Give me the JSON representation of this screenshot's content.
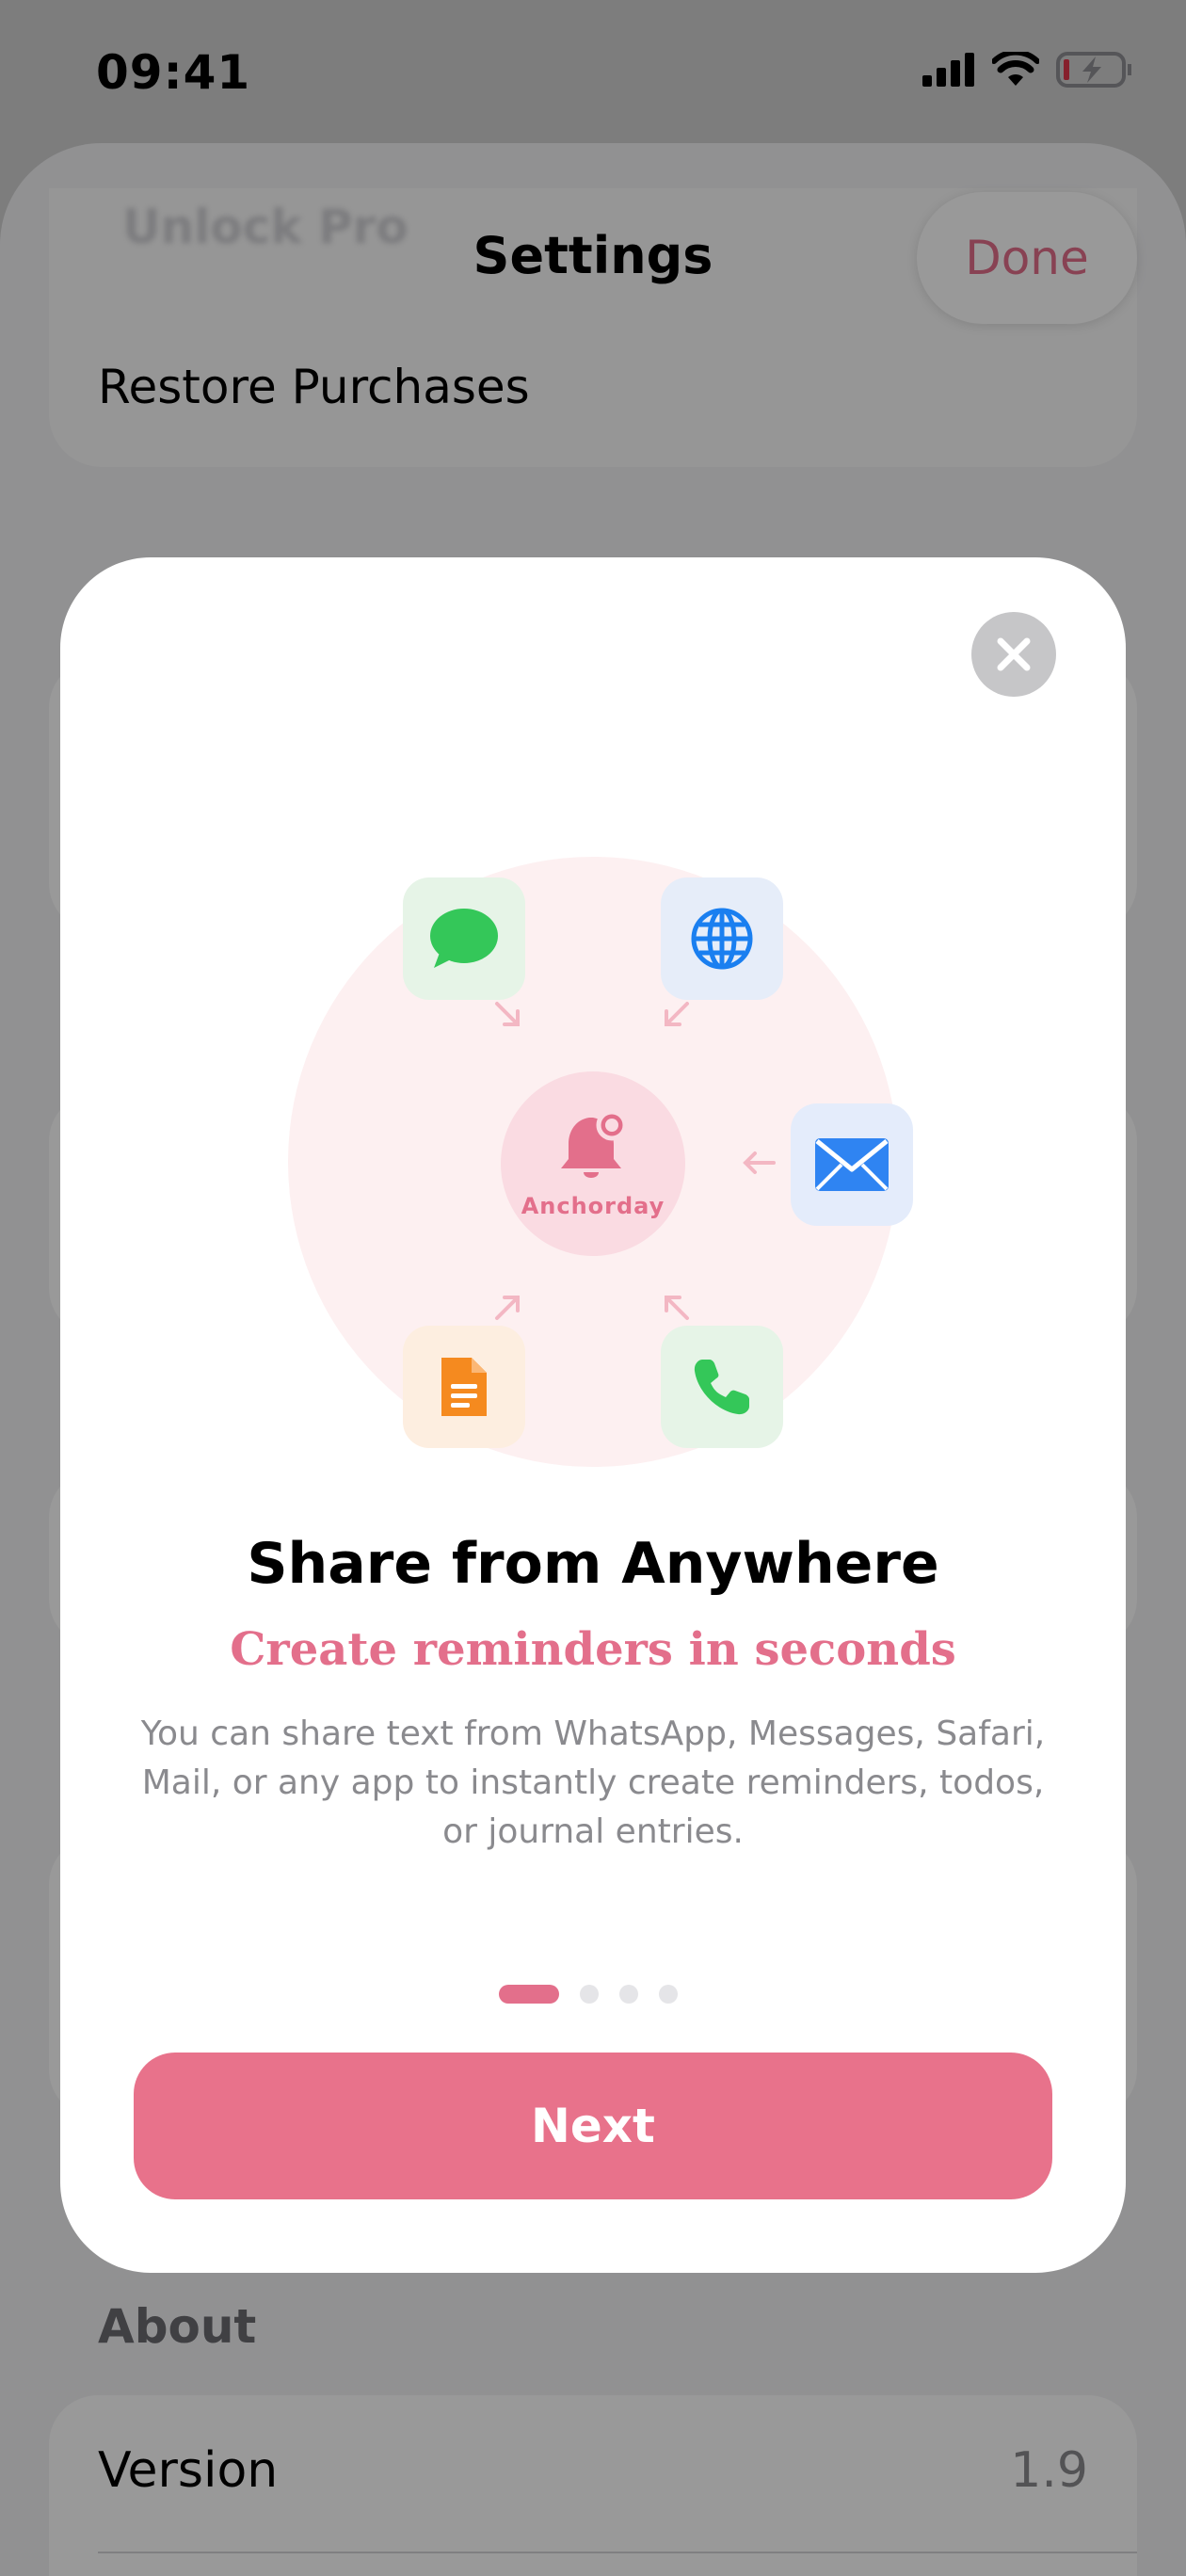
{
  "status_bar": {
    "time": "09:41"
  },
  "settings": {
    "title": "Settings",
    "ghost_row": "Unlock Pro",
    "done_label": "Done",
    "restore_label": "Restore Purchases",
    "about_section": "About",
    "version_label": "Version",
    "version_value": "1.9"
  },
  "onboarding": {
    "center_label": "Anchorday",
    "title": "Share from Anywhere",
    "subtitle": "Create reminders in seconds",
    "description": "You can share text from WhatsApp, Messages, Safari, Mail, or any app to instantly create reminders, todos, or journal entries.",
    "page_count": 4,
    "current_page": 1,
    "next_label": "Next",
    "source_icons": [
      "messages-icon",
      "safari-globe-icon",
      "mail-icon",
      "notes-document-icon",
      "phone-icon"
    ]
  },
  "colors": {
    "accent": "#e8728b",
    "accent_text": "#e36f8b",
    "center_fill": "#fadbe2",
    "illustration_bg": "#fdf0f1"
  }
}
